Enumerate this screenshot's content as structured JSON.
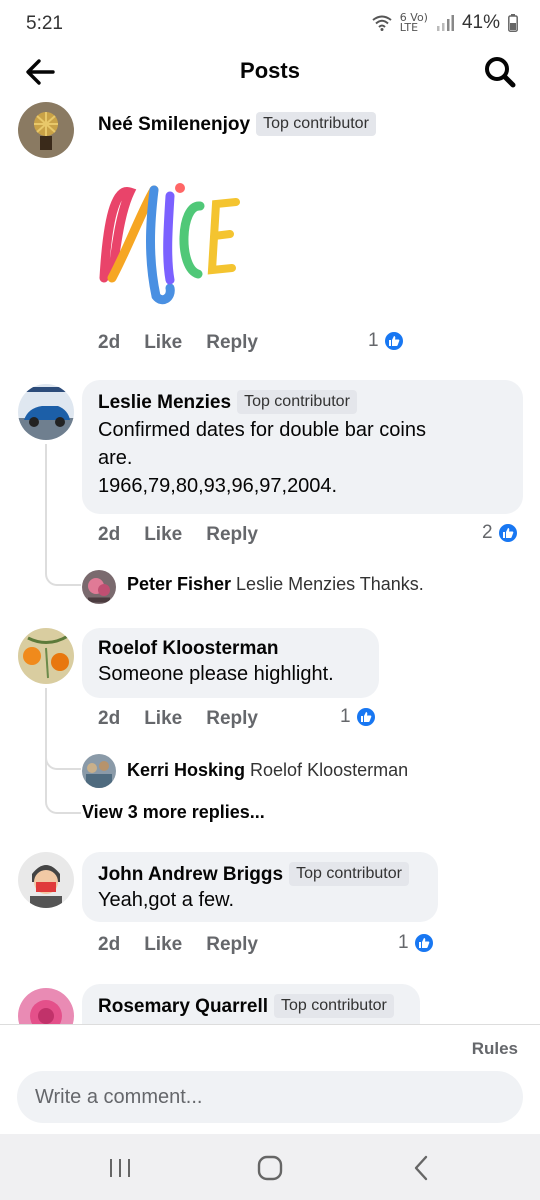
{
  "status_bar": {
    "time": "5:21",
    "indicator_top": "6 Vo)",
    "indicator_bottom": "LTE",
    "battery_percent": "41%"
  },
  "header": {
    "title": "Posts"
  },
  "comments": [
    {
      "name": "Neé Smilenenjoy",
      "badge": "Top contributor",
      "sticker_icon": "nice-sticker",
      "time": "2d",
      "like": "Like",
      "reply": "Reply",
      "reaction_count": "1"
    },
    {
      "name": "Leslie Menzies",
      "badge": "Top contributor",
      "text_line1": "Confirmed dates for double bar coins",
      "text_line2": "are.",
      "text_line3": "1966,79,80,93,96,97,2004.",
      "time": "2d",
      "like": "Like",
      "reply": "Reply",
      "reaction_count": "2",
      "reply_preview": {
        "name": "Peter Fisher",
        "text": "Leslie Menzies Thanks."
      }
    },
    {
      "name": "Roelof Kloosterman",
      "text": "Someone please highlight.",
      "time": "2d",
      "like": "Like",
      "reply": "Reply",
      "reaction_count": "1",
      "reply_preview": {
        "name": "Kerri Hosking",
        "text": "Roelof Kloosterman"
      },
      "more_replies": "View 3 more replies..."
    },
    {
      "name": "John Andrew Briggs",
      "badge": "Top contributor",
      "text": "Yeah,got a few.",
      "time": "2d",
      "like": "Like",
      "reply": "Reply",
      "reaction_count": "1"
    },
    {
      "name": "Rosemary Quarrell",
      "badge": "Top contributor"
    }
  ],
  "footer": {
    "rules": "Rules",
    "comment_placeholder": "Write a comment..."
  },
  "colors": {
    "like_blue": "#1877f2",
    "bubble_gray": "#f0f2f5",
    "meta_gray": "#65676b"
  }
}
